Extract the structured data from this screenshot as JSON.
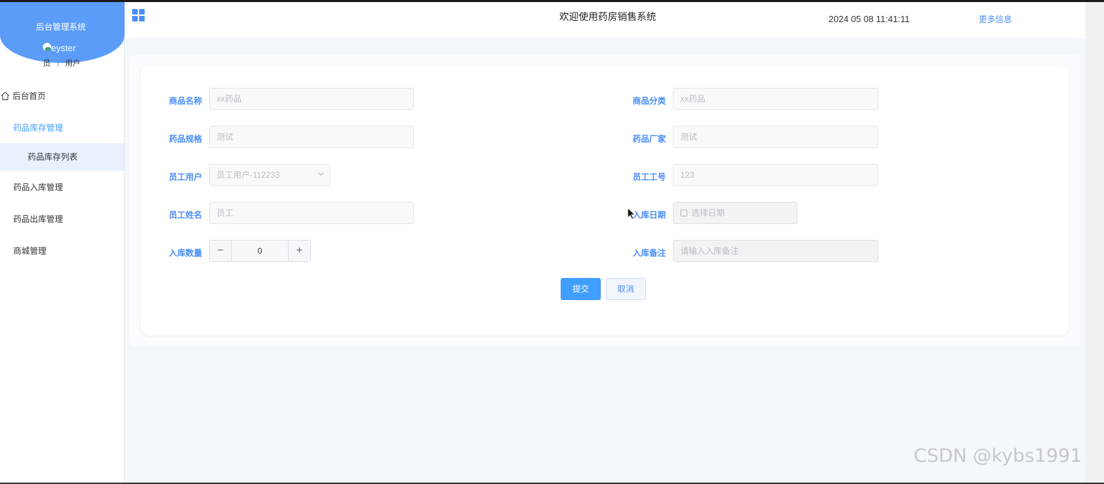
{
  "sidebar": {
    "system_title": "后台管理系统",
    "user_name": "eyster",
    "role_left": "员",
    "role_right": "用户",
    "menu": [
      {
        "label": "后台首页"
      },
      {
        "label": "药品库存管理"
      },
      {
        "label": "药品库存列表"
      },
      {
        "label": "药品入库管理"
      },
      {
        "label": "药品出库管理"
      },
      {
        "label": "商城管理"
      }
    ]
  },
  "header": {
    "title": "欢迎使用药房销售系统",
    "datetime": "2024 05 08 11:41:11",
    "more_link": "更多信息"
  },
  "form": {
    "product_name": {
      "label": "商品名称",
      "placeholder": "xx药品"
    },
    "product_category": {
      "label": "商品分类",
      "placeholder": "xx药品"
    },
    "drug_spec": {
      "label": "药品规格",
      "placeholder": "测试"
    },
    "drug_manufacturer": {
      "label": "药品厂家",
      "placeholder": "测试"
    },
    "employee_user": {
      "label": "员工用户",
      "value": "员工用户-112233"
    },
    "employee_id": {
      "label": "员工工号",
      "value": "123"
    },
    "employee_name": {
      "label": "员工姓名",
      "value": "员工"
    },
    "stock_date": {
      "label": "入库日期",
      "placeholder": "选择日期"
    },
    "stock_qty": {
      "label": "入库数量",
      "value": "0"
    },
    "stock_note": {
      "label": "入库备注",
      "placeholder": "请输入入库备注"
    },
    "submit_label": "提交",
    "cancel_label": "取消"
  },
  "watermark": "CSDN @kybs1991",
  "colors": {
    "accent": "#409eff",
    "logo_bg": "#5a9cf8",
    "content_bg": "#f3f8fd"
  }
}
